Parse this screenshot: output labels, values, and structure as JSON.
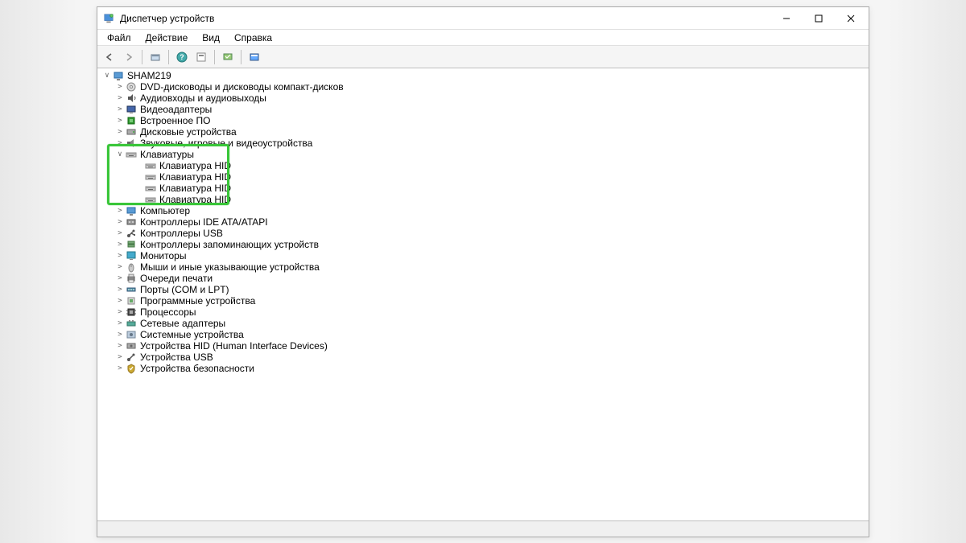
{
  "window": {
    "title": "Диспетчер устройств"
  },
  "menu": {
    "file": "Файл",
    "action": "Действие",
    "view": "Вид",
    "help": "Справка"
  },
  "root": {
    "name": "SHAM219"
  },
  "categories": [
    {
      "label": "DVD-дисководы и дисководы компакт-дисков",
      "icon": "disc"
    },
    {
      "label": "Аудиовходы и аудиовыходы",
      "icon": "audio"
    },
    {
      "label": "Видеоадаптеры",
      "icon": "display"
    },
    {
      "label": "Встроенное ПО",
      "icon": "firmware"
    },
    {
      "label": "Дисковые устройства",
      "icon": "disk"
    },
    {
      "label": "Звуковые, игровые и видеоустройства",
      "icon": "sound"
    }
  ],
  "keyboards": {
    "label": "Клавиатуры",
    "children": [
      "Клавиатура HID",
      "Клавиатура HID",
      "Клавиатура HID",
      "Клавиатура HID"
    ]
  },
  "categories2": [
    {
      "label": "Компьютер",
      "icon": "computer"
    },
    {
      "label": "Контроллеры IDE ATA/ATAPI",
      "icon": "ide"
    },
    {
      "label": "Контроллеры USB",
      "icon": "usb"
    },
    {
      "label": "Контроллеры запоминающих устройств",
      "icon": "storage"
    },
    {
      "label": "Мониторы",
      "icon": "monitor"
    },
    {
      "label": "Мыши и иные указывающие устройства",
      "icon": "mouse"
    },
    {
      "label": "Очереди печати",
      "icon": "printer"
    },
    {
      "label": "Порты (COM и LPT)",
      "icon": "port"
    },
    {
      "label": "Программные устройства",
      "icon": "software"
    },
    {
      "label": "Процессоры",
      "icon": "cpu"
    },
    {
      "label": "Сетевые адаптеры",
      "icon": "network"
    },
    {
      "label": "Системные устройства",
      "icon": "system"
    },
    {
      "label": "Устройства HID (Human Interface Devices)",
      "icon": "hid"
    },
    {
      "label": "Устройства USB",
      "icon": "usbdev"
    },
    {
      "label": "Устройства безопасности",
      "icon": "security"
    }
  ]
}
